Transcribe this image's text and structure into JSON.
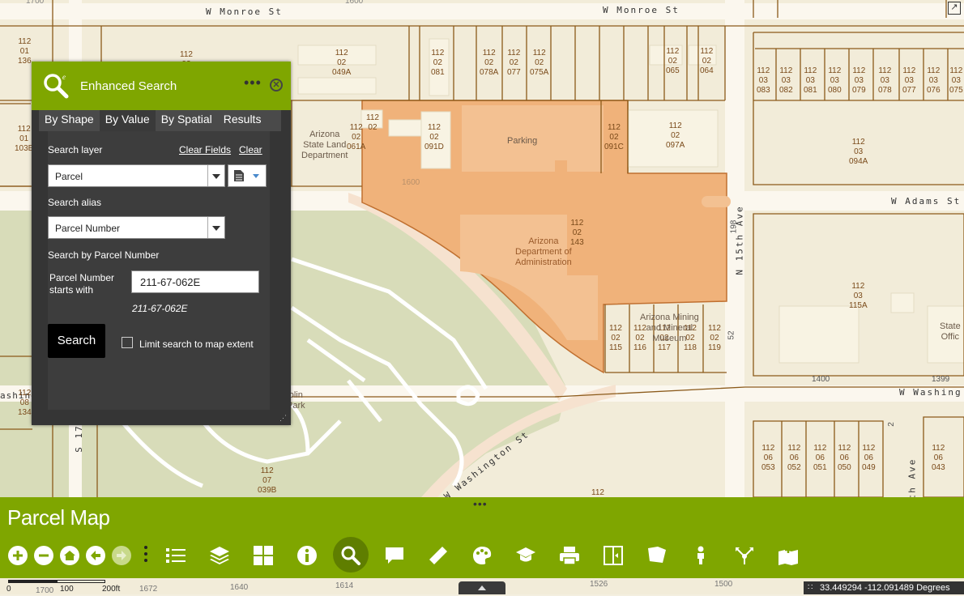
{
  "search_panel": {
    "title": "Enhanced Search",
    "more": "•••",
    "close": "✕",
    "tabs": [
      "By Shape",
      "By Value",
      "By Spatial",
      "Results"
    ],
    "active_tab": "By Value",
    "search_layer_label": "Search layer",
    "clear_fields": "Clear Fields",
    "clear": "Clear",
    "search_layer_value": "Parcel",
    "search_alias_label": "Search alias",
    "search_alias_value": "Parcel Number",
    "search_by_label": "Search by Parcel Number",
    "field_label_1": "Parcel Number",
    "field_label_2": "starts with",
    "field_value": "211-67-062E",
    "field_hint": "211-67-062E",
    "search_button": "Search",
    "limit_label": "Limit search to map extent"
  },
  "bottom_bar": {
    "handle": "•••",
    "app_title": "Parcel Map",
    "tools": [
      "zoom-in",
      "zoom-out",
      "home",
      "back",
      "forward",
      "more",
      "legend",
      "layers",
      "basemap",
      "identify",
      "search",
      "comment",
      "measure",
      "draw",
      "education",
      "print",
      "swipe",
      "bookmark",
      "streetview",
      "share",
      "add-data"
    ]
  },
  "scalebar": {
    "labels": [
      "0",
      "100",
      "200ft"
    ]
  },
  "coordinates": "33.449294 -112.091489 Degrees",
  "map": {
    "streets": [
      "W Monroe St",
      "W Monroe St",
      "W Adams St",
      "N 15th Ave",
      "W Washing",
      "W Washington St",
      "S 17",
      "th Ave",
      "ashingt"
    ],
    "address_numbers": [
      "1700",
      "1600",
      "1400",
      "1399",
      "198",
      "52",
      "2",
      "1672",
      "1640",
      "1614",
      "1526",
      "1500",
      "1700",
      "1600"
    ],
    "parcels": [
      "112\n01\n136",
      "112\n02",
      "112\n01\n103B",
      "112\n08\n134",
      "112\n02\n049A",
      "112\n02\n081",
      "112\n02\n078A",
      "112\n02\n077",
      "112\n02\n075A",
      "112\n02\n065",
      "112\n02\n064",
      "112\n03\n083",
      "112\n03\n082",
      "112\n03\n081",
      "112\n03\n080",
      "112\n03\n079",
      "112\n03\n078",
      "112\n03\n077",
      "112\n03\n076",
      "112\n03\n075",
      "112\n02",
      "112\n02\n061A",
      "112\n02\n091D",
      "112\n02\n091C",
      "112\n02\n097A",
      "112\n03\n094A",
      "112\n02\n143",
      "112\n03\n115A",
      "112\n02\n115",
      "112\n02\n116",
      "112\n02\n117",
      "112\n02\n118",
      "112\n02\n119",
      "112\n07\n039B",
      "112",
      "112\n06\n053",
      "112\n06\n052",
      "112\n06\n051",
      "112\n06\n050",
      "112\n06\n049",
      "112\n06\n043"
    ],
    "places": [
      "Arizona\nState Land\nDepartment",
      "Parking",
      "Arizona\nDepartment of\nAdministration",
      "Arizona Mining\nand Mineral\nMuseum",
      "State\nOffic",
      "olin\nPark"
    ]
  }
}
